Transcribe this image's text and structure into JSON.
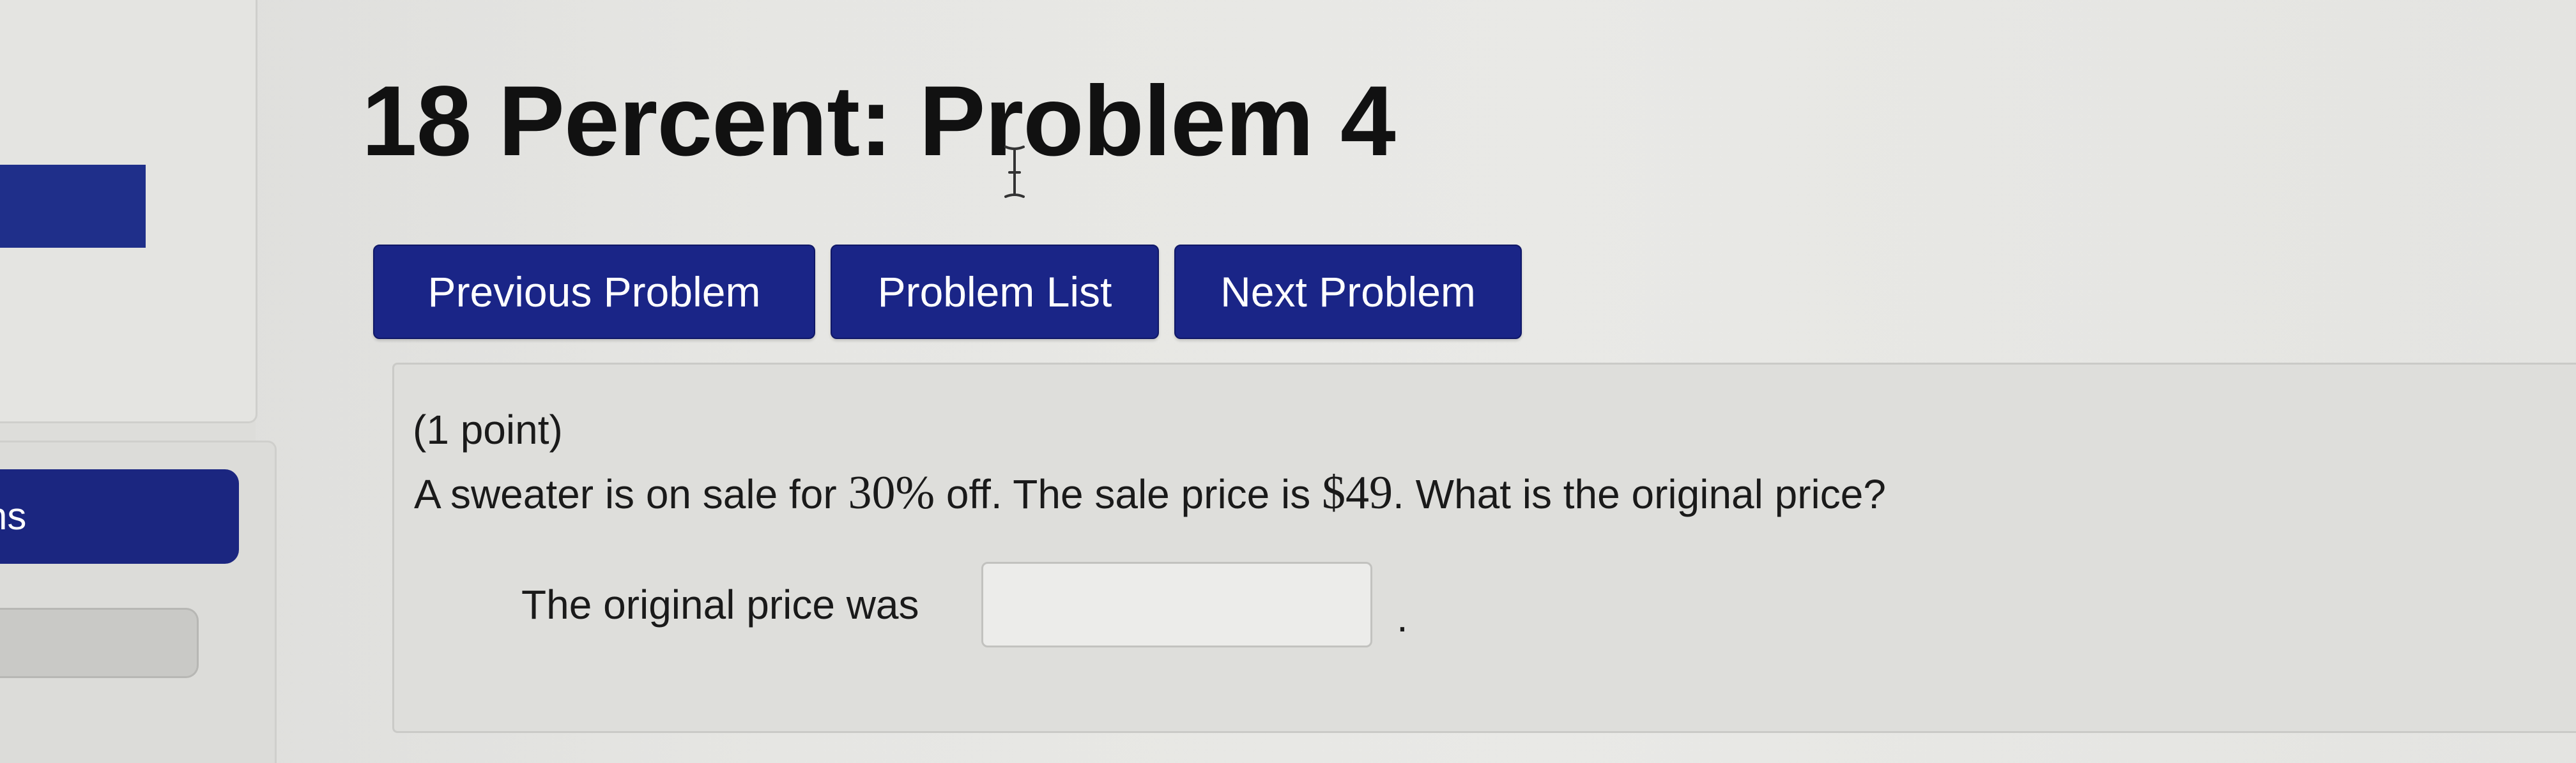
{
  "title": "18 Percent: Problem 4",
  "nav": {
    "previous_label": "Previous Problem",
    "list_label": "Problem List",
    "next_label": "Next Problem"
  },
  "sidebar": {
    "nav_button_label": "ns"
  },
  "problem": {
    "points": "(1 point)",
    "question_part1": "A sweater is on sale for ",
    "discount": "30%",
    "question_part2": " off. The sale price is ",
    "sale_price": "$49",
    "question_part3": ". What is the original price?",
    "answer_label": "The original price was",
    "answer_value": "",
    "answer_suffix": "."
  },
  "colors": {
    "button_blue": "#1a2587",
    "background": "#e6e6e3"
  },
  "icons": {
    "cursor": "text-cursor-icon"
  }
}
